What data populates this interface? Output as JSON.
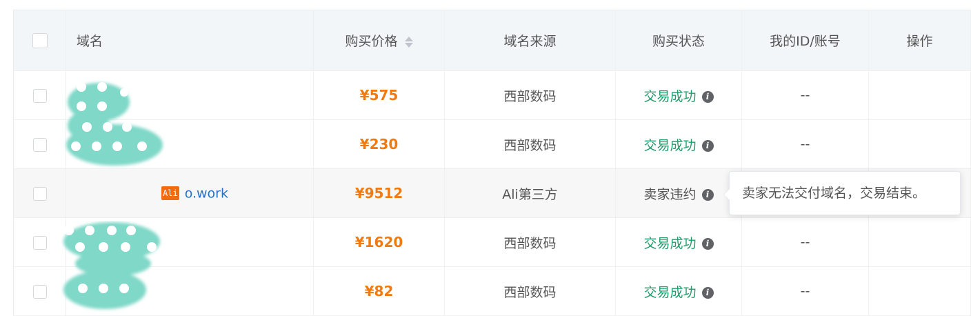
{
  "table": {
    "headers": {
      "domain": "域名",
      "price": "购买价格",
      "source": "域名来源",
      "status": "购买状态",
      "account": "我的ID/账号",
      "action": "操作"
    },
    "rows": [
      {
        "domain": "",
        "price": "¥575",
        "source": "西部数码",
        "status": "交易成功",
        "account": "--"
      },
      {
        "domain": "",
        "price": "¥230",
        "source": "西部数码",
        "status": "交易成功",
        "account": "--"
      },
      {
        "domain": "o.work",
        "badge": "Ali",
        "price": "¥9512",
        "source": "Ali第三方",
        "status": "卖家违约",
        "account": ""
      },
      {
        "domain": "",
        "price": "¥1620",
        "source": "西部数码",
        "status": "交易成功",
        "account": "--"
      },
      {
        "domain": "",
        "price": "¥82",
        "source": "西部数码",
        "status": "交易成功",
        "account": "--"
      }
    ]
  },
  "tooltip": {
    "text": "卖家无法交付域名，交易结束。"
  },
  "icons": {
    "info": "info-icon",
    "sort": "sort-icon",
    "checkbox": "checkbox-icon"
  },
  "colors": {
    "price": "#f07b13",
    "success": "#1e9c6a",
    "link": "#2273c7",
    "ali_badge": "#f26b0f",
    "redaction": "#7fd8c8"
  }
}
